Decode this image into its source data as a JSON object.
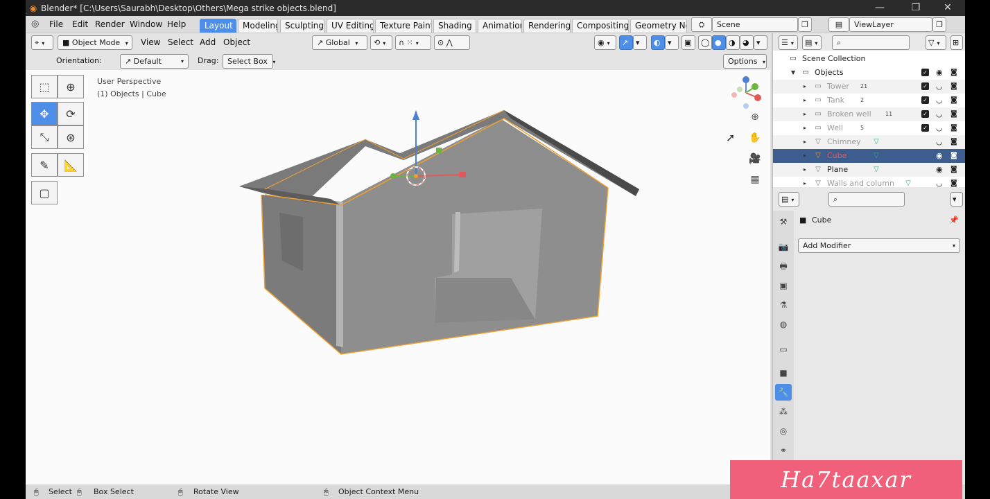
{
  "window": {
    "title": "Blender* [C:\\Users\\Saurabh\\Desktop\\Others\\Mega strike objects.blend]",
    "minimize": "—",
    "maximize": "❐",
    "close": "✕"
  },
  "menu": [
    "File",
    "Edit",
    "Render",
    "Window",
    "Help"
  ],
  "workspaces": [
    "Layout",
    "Modeling",
    "Sculpting",
    "UV Editing",
    "Texture Paint",
    "Shading",
    "Animation",
    "Rendering",
    "Compositing",
    "Geometry Nod"
  ],
  "active_workspace": "Layout",
  "scene": {
    "name": "Scene",
    "view_layer": "ViewLayer"
  },
  "viewport_header": {
    "mode": "Object Mode",
    "menus": [
      "View",
      "Select",
      "Add",
      "Object"
    ],
    "transform_orientation": "Global"
  },
  "tool_header": {
    "orientation_label": "Orientation:",
    "orientation_value": "Default",
    "drag_label": "Drag:",
    "drag_value": "Select Box",
    "options_label": "Options"
  },
  "viewport": {
    "perspective": "User Perspective",
    "context": "(1) Objects | Cube"
  },
  "outliner": {
    "root": "Scene Collection",
    "collection": "Objects",
    "items": [
      {
        "name": "Tower",
        "badge": "21",
        "enabled": true,
        "dimmed": true
      },
      {
        "name": "Tank",
        "badge": "2",
        "enabled": true,
        "dimmed": true
      },
      {
        "name": "Broken well",
        "badge": "11",
        "enabled": true,
        "dimmed": true
      },
      {
        "name": "Well",
        "badge": "5",
        "enabled": true,
        "dimmed": true
      },
      {
        "name": "Chimney",
        "badge": "",
        "enabled": false,
        "dimmed": true
      },
      {
        "name": "Cube",
        "badge": "",
        "enabled": false,
        "dimmed": false,
        "selected": true
      },
      {
        "name": "Plane",
        "badge": "",
        "enabled": false,
        "dimmed": false
      },
      {
        "name": "Walls and column",
        "badge": "",
        "enabled": false,
        "dimmed": true
      }
    ]
  },
  "properties": {
    "object_name": "Cube",
    "add_modifier": "Add Modifier"
  },
  "statusbar": {
    "select": "Select",
    "box_select": "Box Select",
    "rotate_view": "Rotate View",
    "context_menu": "Object Context Menu"
  },
  "watermark": "Ha7taaxar",
  "colors": {
    "accent": "#4d8ee8",
    "selection_outline": "#f0a030",
    "watermark_bg": "#f0607a"
  }
}
